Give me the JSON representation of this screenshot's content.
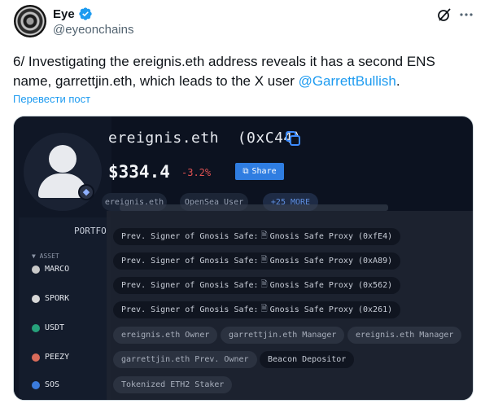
{
  "author": {
    "name": "Eye",
    "handle": "@eyeonchains"
  },
  "tweet": {
    "text_before": "6/ Investigating the ereignis.eth address reveals it has a second ENS name, garrettjin.eth, which leads to the X user ",
    "mention": "@GarrettBullish",
    "text_after": ".",
    "translate_label": "Перевести пост"
  },
  "media": {
    "ens_title": "ereignis.eth  (0xC44)",
    "balance": "$334.4",
    "change": "-3.2%",
    "share_label": "Share",
    "tags": [
      "ereignis.eth",
      "OpenSea User",
      "+25 MORE"
    ],
    "portfolio_label": "PORTFO",
    "asset_header": "ASSET",
    "assets": [
      {
        "name": "MARCO",
        "color": "#c9c9c9"
      },
      {
        "name": "SPORK",
        "color": "#d8d8d8"
      },
      {
        "name": "USDT",
        "color": "#26a17b"
      },
      {
        "name": "PEEZY",
        "color": "#d96b5a"
      },
      {
        "name": "SOS",
        "color": "#3b7bdc"
      }
    ],
    "labels": [
      {
        "prefix": "Prev. Signer of Gnosis Safe:",
        "target": "Gnosis Safe Proxy (0xfE4)"
      },
      {
        "prefix": "Prev. Signer of Gnosis Safe:",
        "target": "Gnosis Safe Proxy (0xA89)"
      },
      {
        "prefix": "Prev. Signer of Gnosis Safe:",
        "target": "Gnosis Safe Proxy (0x562)"
      },
      {
        "prefix": "Prev. Signer of Gnosis Safe:",
        "target": "Gnosis Safe Proxy (0x261)"
      }
    ],
    "roles_row1": [
      "ereignis.eth Owner",
      "garrettjin.eth Manager",
      "ereignis.eth Manager"
    ],
    "roles_row2": [
      "garrettjin.eth Prev. Owner",
      "Beacon Depositor"
    ],
    "roles_row3": [
      "Tokenized ETH2 Staker"
    ]
  },
  "colors": {
    "accent": "#1d9bf0",
    "share_button": "#2f7de1",
    "negative": "#e05252"
  }
}
